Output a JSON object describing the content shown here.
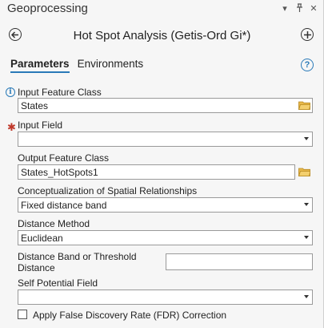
{
  "window": {
    "title": "Geoprocessing"
  },
  "titlebar_icons": [
    "dropdown-arrow-icon",
    "pin-icon",
    "close-icon"
  ],
  "tool": {
    "title": "Hot Spot Analysis (Getis-Ord Gi*)"
  },
  "tabs": [
    {
      "label": "Parameters",
      "active": true
    },
    {
      "label": "Environments",
      "active": false
    }
  ],
  "params": {
    "input_feature_class": {
      "label": "Input Feature Class",
      "value": "States"
    },
    "input_field": {
      "label": "Input Field",
      "value": ""
    },
    "output_feature_class": {
      "label": "Output Feature Class",
      "value": "States_HotSpots1"
    },
    "conceptualization": {
      "label": "Conceptualization of Spatial Relationships",
      "value": "Fixed distance band"
    },
    "distance_method": {
      "label": "Distance Method",
      "value": "Euclidean"
    },
    "distance_band": {
      "label_line1": "Distance Band or Threshold",
      "label_line2": "Distance",
      "value": ""
    },
    "self_potential": {
      "label": "Self Potential Field",
      "value": ""
    },
    "fdr": {
      "label": "Apply False Discovery Rate (FDR) Correction",
      "checked": false
    }
  },
  "colors": {
    "accent": "#2a7ab8",
    "required": "#c0392b",
    "folder": "#e8b84a"
  }
}
